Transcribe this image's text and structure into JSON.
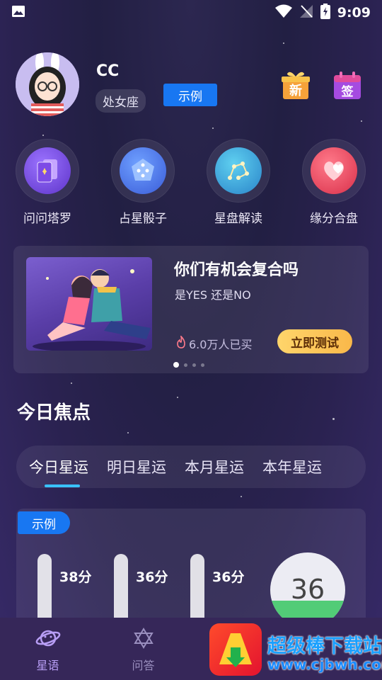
{
  "status_bar": {
    "time": "9:09"
  },
  "profile": {
    "name": "CC",
    "zodiac": "处女座",
    "example_label": "示例",
    "gift_text": "新",
    "sign_text": "签"
  },
  "features": [
    {
      "label": "问问塔罗",
      "icon": "tarot-icon"
    },
    {
      "label": "占星骰子",
      "icon": "dice-icon"
    },
    {
      "label": "星盘解读",
      "icon": "constellation-icon"
    },
    {
      "label": "缘分合盘",
      "icon": "heart-icon"
    }
  ],
  "banner": {
    "title": "你们有机会复合吗",
    "subtitle": "是YES 还是NO",
    "sold": "6.0万人已买",
    "cta": "立即测试",
    "active_slide": 1,
    "slide_count": 4
  },
  "focus": {
    "title": "今日焦点",
    "tabs": [
      "今日星运",
      "明日星运",
      "本月星运",
      "本年星运"
    ],
    "active_tab": 0
  },
  "score_card": {
    "badge": "示例",
    "bars": [
      {
        "label": "38分",
        "value": 38,
        "color": "#ff5a6a"
      },
      {
        "label": "36分",
        "value": 36,
        "color": "#4aa8ff"
      },
      {
        "label": "36分",
        "value": 36,
        "color": "#ffa63d"
      }
    ],
    "overall": "36",
    "overall_value": 36
  },
  "bottom_nav": [
    {
      "label": "星语",
      "icon": "planet-icon",
      "active": true
    },
    {
      "label": "问答",
      "icon": "star-of-david-icon",
      "active": false
    }
  ],
  "watermark": {
    "cn": "超级棒下载站",
    "url": "www.cjbwh.com"
  },
  "colors": {
    "accent_blue": "#1877f2",
    "tab_indicator": "#39c2ff",
    "cta": "#ffd56b"
  }
}
